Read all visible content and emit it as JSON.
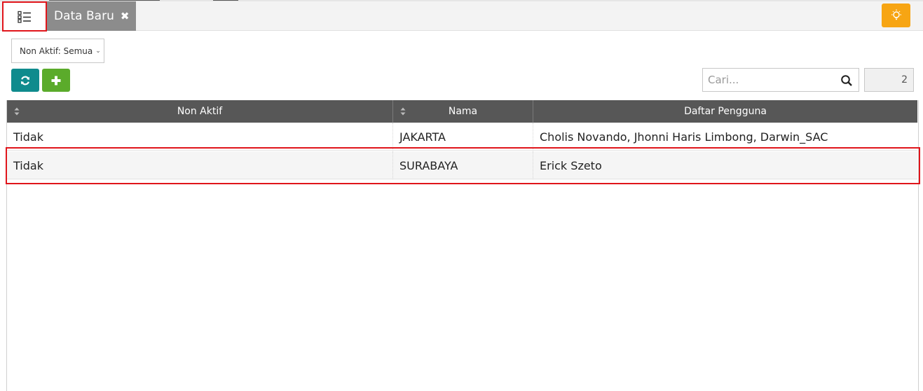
{
  "tabs": {
    "menu_icon": "list-icon",
    "active_tab_label": "Data Baru",
    "close_symbol": "✖"
  },
  "toolbar": {
    "filter_label": "Non Aktif: Semua",
    "refresh_icon": "refresh-icon",
    "add_icon": "plus-icon",
    "help_icon": "lightbulb-icon",
    "search_placeholder": "Cari...",
    "record_count": "2"
  },
  "table": {
    "columns": [
      "Non Aktif",
      "Nama",
      "Daftar Pengguna"
    ],
    "rows": [
      [
        "Tidak",
        "JAKARTA",
        "Cholis Novando, Jhonni Haris Limbong, Darwin_SAC"
      ],
      [
        "Tidak",
        "SURABAYA",
        "Erick Szeto"
      ]
    ]
  },
  "colors": {
    "accent_teal": "#0f8b8d",
    "accent_green": "#5bab2b",
    "accent_orange": "#f7a513",
    "header_bg": "#575757",
    "highlight_red": "#e0151b"
  }
}
